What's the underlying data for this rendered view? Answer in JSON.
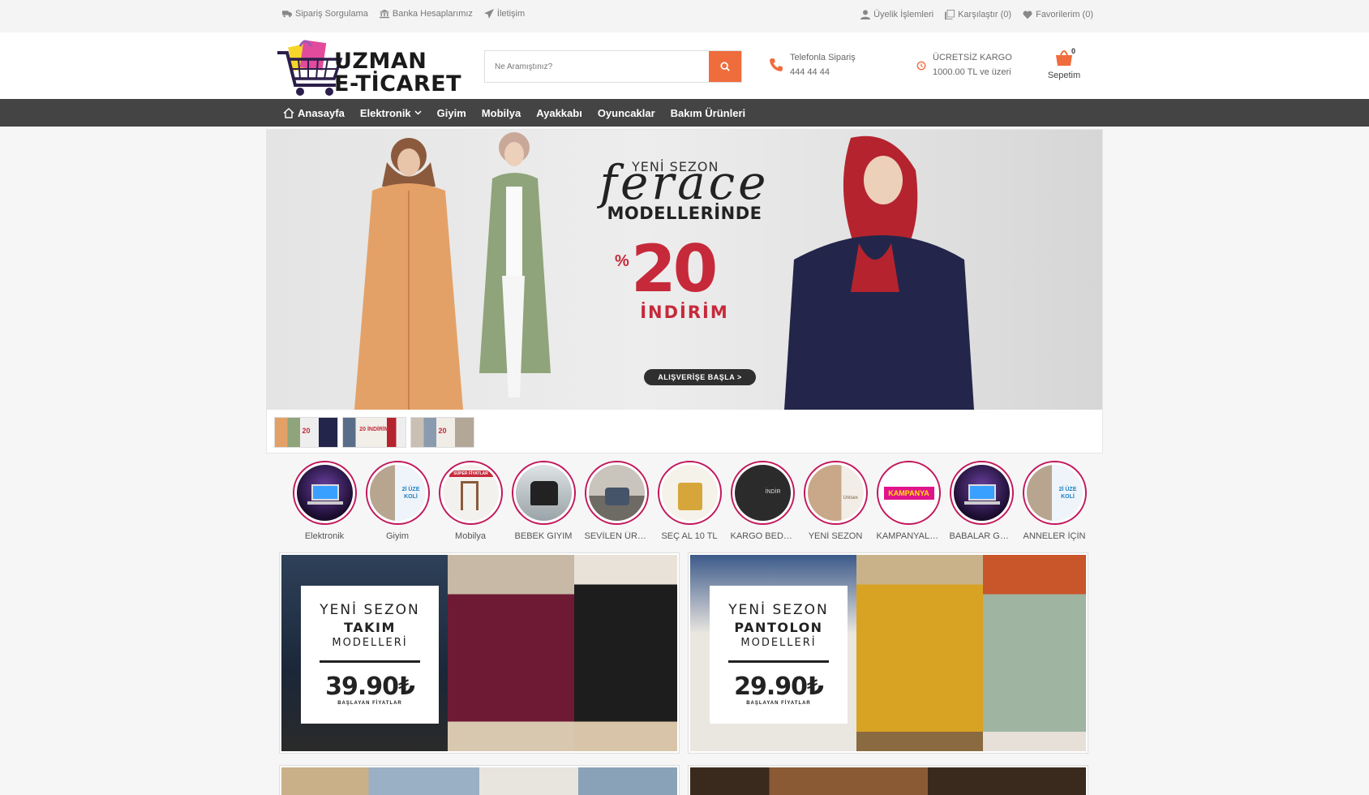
{
  "topbar": {
    "left_links": [
      {
        "label": "Sipariş Sorgulama",
        "icon": "truck-icon"
      },
      {
        "label": "Banka Hesaplarımız",
        "icon": "bank-icon"
      },
      {
        "label": "İletişim",
        "icon": "send-icon"
      }
    ],
    "right_links": [
      {
        "label": "Üyelik İşlemleri",
        "icon": "user-icon"
      },
      {
        "label": "Karşılaştır (0)",
        "icon": "compare-icon"
      },
      {
        "label": "Favorilerim (0)",
        "icon": "heart-icon"
      }
    ]
  },
  "header": {
    "logo_line1": "UZMAN",
    "logo_line2": "E-TİCARET",
    "search_placeholder": "Ne Aramıştınız?",
    "phone_title": "Telefonla Sipariş",
    "phone_number": "444 44 44",
    "shipping_title": "ÜCRETSİZ KARGO",
    "shipping_sub": "1000.00 TL ve üzeri",
    "cart_label": "Sepetim",
    "cart_count": "0"
  },
  "nav": {
    "home": "Anasayfa",
    "items": [
      "Elektronik",
      "Giyim",
      "Mobilya",
      "Ayakkabı",
      "Oyuncaklar",
      "Bakım Ürünleri"
    ]
  },
  "banner": {
    "line1": "YENİ SEZON",
    "script": "ferace",
    "line2": "MODELLERİNDE",
    "percent_sign": "%",
    "percent": "20",
    "discount": "İNDİRİM",
    "cta": "ALIŞVERİŞE BAŞLA  >",
    "thumb_labels": [
      "20",
      "20 İNDİRİM",
      "20"
    ]
  },
  "stories": [
    "Elektronik",
    "Giyim",
    "Mobilya",
    "BEBEK GIYIM",
    "SEVİLEN ÜRÜNLER",
    "SEÇ AL 10 TL",
    "KARGO BEDAVA",
    "YENİ SEZON",
    "KAMPANYALI ÜRÜNLER",
    "BABALAR GÜNÜ",
    "ANNELER İÇİN"
  ],
  "story_badges": {
    "giyim": "2İ ÜZE KOLİ",
    "mobilya": "SÜPER FİYATLAR",
    "kargo": "İNDİR",
    "yeni": "Unisex",
    "kampanya": "KAMPANYA"
  },
  "promos": [
    {
      "l1": "YENİ SEZON",
      "l2": "TAKIM",
      "l3": "MODELLERİ",
      "price": "39.90₺",
      "sub": "BAŞLAYAN FİYATLAR"
    },
    {
      "l1": "YENİ SEZON",
      "l2": "PANTOLON",
      "l3": "MODELLERİ",
      "price": "29.90₺",
      "sub": "BAŞLAYAN FİYATLAR"
    }
  ],
  "colors": {
    "accent": "#ef6c3c",
    "nav_bg": "#444444",
    "story_ring": "#c2185b",
    "sale_red": "#c62a3a"
  }
}
